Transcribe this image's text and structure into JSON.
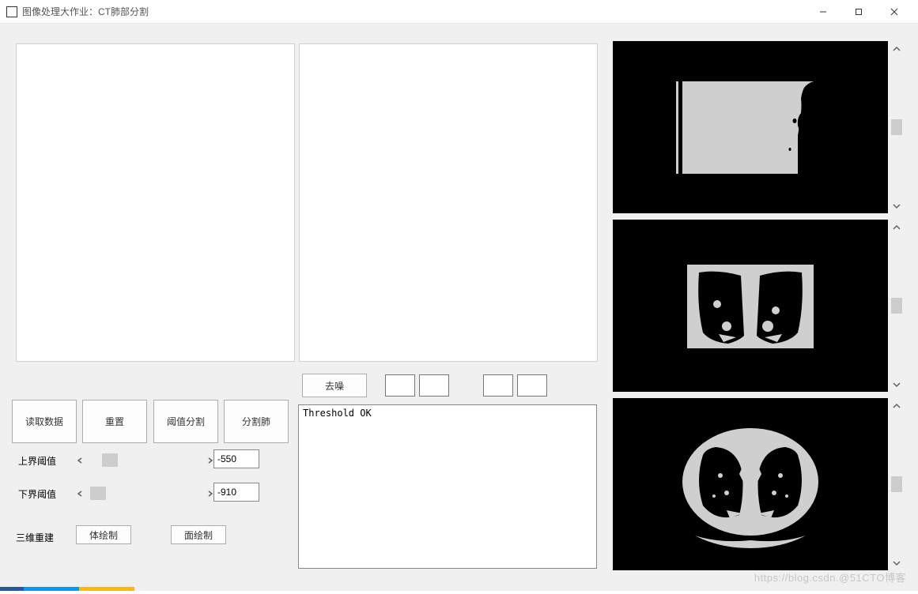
{
  "window": {
    "title": "图像处理大作业：CT肺部分割",
    "minimize": "—",
    "maximize": "☐",
    "close": "✕"
  },
  "buttons": {
    "read": "读取数据",
    "reset": "重置",
    "threshold": "阈值分割",
    "segment": "分割肺",
    "denoise": "去噪",
    "volume_render": "体绘制",
    "surface_render": "面绘制"
  },
  "labels": {
    "upper_threshold": "上界阈值",
    "lower_threshold": "下界阈值",
    "reconstruct_3d": "三维重建"
  },
  "values": {
    "upper_threshold": "-550",
    "lower_threshold": "-910"
  },
  "log": {
    "text": "Threshold OK"
  },
  "watermark": "https://blog.csdn.@51CTO博客",
  "views": {
    "sagittal": "sagittal-ct-view",
    "coronal": "coronal-ct-view",
    "axial": "axial-ct-view"
  }
}
